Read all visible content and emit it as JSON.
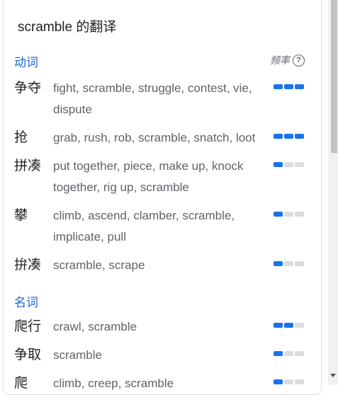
{
  "title": "scramble 的翻译",
  "frequency_label": "频率",
  "help_glyph": "?",
  "sections": [
    {
      "pos": "动词",
      "entries": [
        {
          "term": "争夺",
          "synonyms": "fight, scramble, struggle, contest, vie, dispute",
          "frequency": 3
        },
        {
          "term": "抢",
          "synonyms": "grab, rush, rob, scramble, snatch, loot",
          "frequency": 3
        },
        {
          "term": "拼凑",
          "synonyms": "put together, piece, make up, knock together, rig up, scramble",
          "frequency": 1
        },
        {
          "term": "攀",
          "synonyms": "climb, ascend, clamber, scramble, implicate, pull",
          "frequency": 1
        },
        {
          "term": "拚凑",
          "synonyms": "scramble, scrape",
          "frequency": 1
        }
      ]
    },
    {
      "pos": "名词",
      "entries": [
        {
          "term": "爬行",
          "synonyms": "crawl, scramble",
          "frequency": 2
        },
        {
          "term": "争取",
          "synonyms": "scramble",
          "frequency": 1
        },
        {
          "term": "爬",
          "synonyms": "climb, creep, scramble",
          "frequency": 1
        }
      ]
    }
  ],
  "colors": {
    "accent": "#1a73e8",
    "pos_label": "#1967d2",
    "bar_off": "#dadce0",
    "synonym_text": "#5f6368"
  }
}
